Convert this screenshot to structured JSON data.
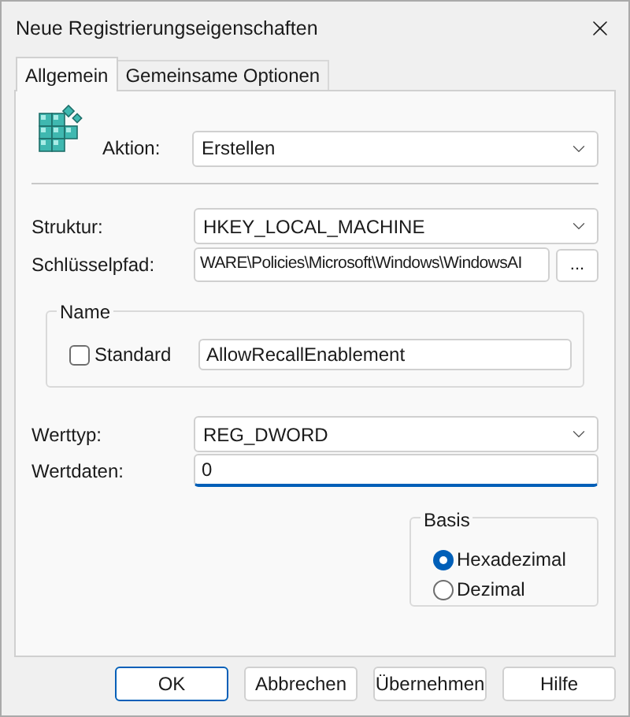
{
  "window": {
    "title": "Neue Registrierungseigenschaften"
  },
  "tabs": [
    {
      "label": "Allgemein",
      "selected": true
    },
    {
      "label": "Gemeinsame Optionen",
      "selected": false
    }
  ],
  "action": {
    "label": "Aktion:",
    "value": "Erstellen"
  },
  "hive": {
    "label": "Struktur:",
    "value": "HKEY_LOCAL_MACHINE"
  },
  "key_path": {
    "label": "Schlüsselpfad:",
    "value": "WARE\\Policies\\Microsoft\\Windows\\WindowsAI",
    "browse": "..."
  },
  "name_group": {
    "title": "Name",
    "default_checkbox": {
      "label": "Standard",
      "checked": false
    },
    "value": "AllowRecallEnablement"
  },
  "value_type": {
    "label": "Werttyp:",
    "value": "REG_DWORD"
  },
  "value_data": {
    "label": "Wertdaten:",
    "value": "0"
  },
  "base_group": {
    "title": "Basis",
    "options": [
      {
        "label": "Hexadezimal",
        "selected": true
      },
      {
        "label": "Dezimal",
        "selected": false
      }
    ]
  },
  "buttons": [
    {
      "label": "OK",
      "default": true
    },
    {
      "label": "Abbrechen",
      "default": false
    },
    {
      "label": "Übernehmen",
      "default": false
    },
    {
      "label": "Hilfe",
      "default": false
    }
  ]
}
